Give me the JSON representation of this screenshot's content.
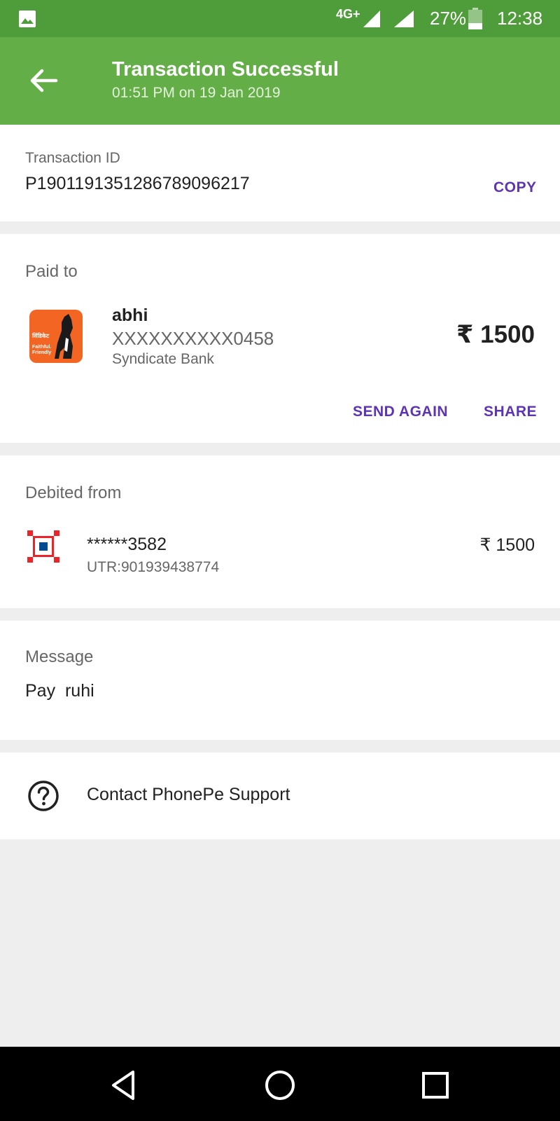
{
  "status_bar": {
    "network": "4G+",
    "battery": "27%",
    "time": "12:38"
  },
  "header": {
    "title": "Transaction Successful",
    "subtitle": "01:51 PM on 19 Jan 2019",
    "back_icon": "arrow-left-icon"
  },
  "transaction": {
    "id_label": "Transaction ID",
    "id_value": "P1901191351286789096217",
    "copy_label": "COPY"
  },
  "paid_to": {
    "section_label": "Paid to",
    "name": "abhi",
    "account": "XXXXXXXXXX0458",
    "bank": "Syndicate Bank",
    "amount": "₹ 1500",
    "send_again_label": "SEND AGAIN",
    "share_label": "SHARE",
    "logo_text_1": "सिंडिकेट",
    "logo_text_2": "Faithful. Friendly"
  },
  "debited_from": {
    "section_label": "Debited from",
    "account": "******3582",
    "utr": "UTR:901939438774",
    "amount": "₹ 1500"
  },
  "message": {
    "section_label": "Message",
    "text": "Pay  ruhi"
  },
  "support": {
    "label": "Contact PhonePe Support",
    "icon": "help-circle-icon"
  },
  "colors": {
    "status_bar": "#4f9d3a",
    "app_bar": "#63ae47",
    "accent": "#5e35b1",
    "syndicate_orange": "#f26522",
    "hdfc_red": "#ed232a",
    "hdfc_blue": "#004c8f"
  }
}
